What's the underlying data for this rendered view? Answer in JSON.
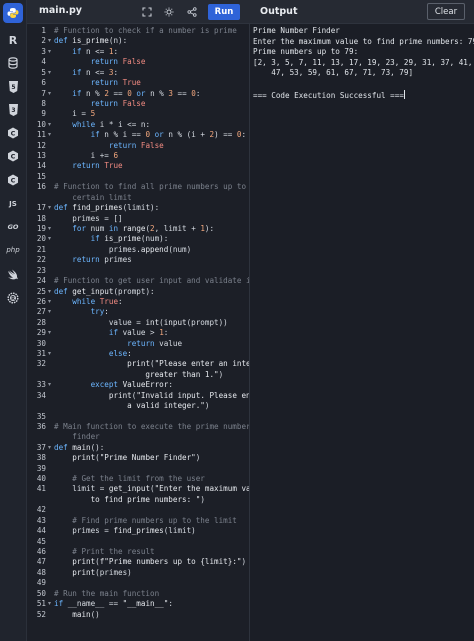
{
  "header": {
    "file_tab": "main.py",
    "run_label": "Run",
    "output_title": "Output",
    "clear_label": "Clear"
  },
  "rail": {
    "icons": [
      "python-icon",
      "r-icon",
      "database-icon",
      "html5-icon",
      "javascript-icon",
      "c-icon",
      "cpp-icon",
      "csharp-icon",
      "js-icon",
      "go-icon",
      "php-icon",
      "swift-icon",
      "rust-icon"
    ],
    "labels": {
      "js": "JS",
      "go": "GO",
      "php": "php"
    }
  },
  "editor": {
    "lines": [
      {
        "n": "1",
        "fold": false,
        "html": "<span class='com'># Function to check if a number is prime</span>"
      },
      {
        "n": "2",
        "fold": true,
        "html": "<span class='kw'>def</span> <span class='fn'>is_prime</span>(n):"
      },
      {
        "n": "3",
        "fold": true,
        "html": "    <span class='kw'>if</span> n &lt;= <span class='num'>1</span>:"
      },
      {
        "n": "4",
        "fold": false,
        "html": "        <span class='kw'>return</span> <span class='bool'>False</span>"
      },
      {
        "n": "5",
        "fold": true,
        "html": "    <span class='kw'>if</span> n &lt;= <span class='num'>3</span>:"
      },
      {
        "n": "6",
        "fold": false,
        "html": "        <span class='kw'>return</span> <span class='bool'>True</span>"
      },
      {
        "n": "7",
        "fold": true,
        "html": "    <span class='kw'>if</span> n % <span class='num'>2</span> == <span class='num'>0</span> <span class='kw'>or</span> n % <span class='num'>3</span> == <span class='num'>0</span>:"
      },
      {
        "n": "8",
        "fold": false,
        "html": "        <span class='kw'>return</span> <span class='bool'>False</span>"
      },
      {
        "n": "9",
        "fold": false,
        "html": "    i = <span class='num'>5</span>"
      },
      {
        "n": "10",
        "fold": true,
        "html": "    <span class='kw'>while</span> i * i &lt;= n:"
      },
      {
        "n": "11",
        "fold": true,
        "html": "        <span class='kw'>if</span> n % i == <span class='num'>0</span> <span class='kw'>or</span> n % (i + <span class='num'>2</span>) == <span class='num'>0</span>:"
      },
      {
        "n": "12",
        "fold": false,
        "html": "            <span class='kw'>return</span> <span class='bool'>False</span>"
      },
      {
        "n": "13",
        "fold": false,
        "html": "        i += <span class='num'>6</span>"
      },
      {
        "n": "14",
        "fold": false,
        "html": "    <span class='kw'>return</span> <span class='bool'>True</span>"
      },
      {
        "n": "15",
        "fold": false,
        "html": ""
      },
      {
        "n": "16",
        "fold": false,
        "html": "<span class='com'># Function to find all prime numbers up to a</span>",
        "wrap": "<span class='com'>    certain limit</span>"
      },
      {
        "n": "17",
        "fold": true,
        "html": "<span class='kw'>def</span> <span class='fn'>find_primes</span>(limit):"
      },
      {
        "n": "18",
        "fold": false,
        "html": "    primes = []"
      },
      {
        "n": "19",
        "fold": true,
        "html": "    <span class='kw'>for</span> num <span class='kw'>in</span> <span class='fn'>range</span>(<span class='num'>2</span>, limit + <span class='num'>1</span>):"
      },
      {
        "n": "20",
        "fold": true,
        "html": "        <span class='kw'>if</span> <span class='fn'>is_prime</span>(num):"
      },
      {
        "n": "21",
        "fold": false,
        "html": "            primes.<span class='fn'>append</span>(num)"
      },
      {
        "n": "22",
        "fold": false,
        "html": "    <span class='kw'>return</span> primes"
      },
      {
        "n": "23",
        "fold": false,
        "html": ""
      },
      {
        "n": "24",
        "fold": false,
        "html": "<span class='com'># Function to get user input and validate it</span>"
      },
      {
        "n": "25",
        "fold": true,
        "html": "<span class='kw'>def</span> <span class='fn'>get_input</span>(prompt):"
      },
      {
        "n": "26",
        "fold": true,
        "html": "    <span class='kw'>while</span> <span class='bool'>True</span>:"
      },
      {
        "n": "27",
        "fold": true,
        "html": "        <span class='kw'>try</span>:"
      },
      {
        "n": "28",
        "fold": false,
        "html": "            value = <span class='fn'>int</span>(<span class='fn'>input</span>(prompt))"
      },
      {
        "n": "29",
        "fold": true,
        "html": "            <span class='kw'>if</span> value &gt; <span class='num'>1</span>:"
      },
      {
        "n": "30",
        "fold": false,
        "html": "                <span class='kw'>return</span> value"
      },
      {
        "n": "31",
        "fold": true,
        "html": "            <span class='kw'>else</span>:"
      },
      {
        "n": "32",
        "fold": false,
        "html": "                <span class='fn'>print</span>(<span class='str'>\"Please enter an integer</span>",
        "wrap": "<span class='str'>                    greater than 1.\"</span>)"
      },
      {
        "n": "33",
        "fold": true,
        "html": "        <span class='kw'>except</span> <span class='fn'>ValueError</span>:"
      },
      {
        "n": "34",
        "fold": false,
        "html": "            <span class='fn'>print</span>(<span class='str'>\"Invalid input. Please enter</span>",
        "wrap": "<span class='str'>                a valid integer.\"</span>)"
      },
      {
        "n": "35",
        "fold": false,
        "html": ""
      },
      {
        "n": "36",
        "fold": false,
        "html": "<span class='com'># Main function to execute the prime number</span>",
        "wrap": "<span class='com'>    finder</span>"
      },
      {
        "n": "37",
        "fold": true,
        "html": "<span class='kw'>def</span> <span class='fn'>main</span>():"
      },
      {
        "n": "38",
        "fold": false,
        "html": "    <span class='fn'>print</span>(<span class='str'>\"Prime Number Finder\"</span>)"
      },
      {
        "n": "39",
        "fold": false,
        "html": ""
      },
      {
        "n": "40",
        "fold": false,
        "html": "    <span class='com'># Get the limit from the user</span>"
      },
      {
        "n": "41",
        "fold": false,
        "html": "    limit = <span class='fn'>get_input</span>(<span class='str'>\"Enter the maximum value</span>",
        "wrap": "<span class='str'>        to find prime numbers: \"</span>)"
      },
      {
        "n": "42",
        "fold": false,
        "html": ""
      },
      {
        "n": "43",
        "fold": false,
        "html": "    <span class='com'># Find prime numbers up to the limit</span>"
      },
      {
        "n": "44",
        "fold": false,
        "html": "    primes = <span class='fn'>find_primes</span>(limit)"
      },
      {
        "n": "45",
        "fold": false,
        "html": ""
      },
      {
        "n": "46",
        "fold": false,
        "html": "    <span class='com'># Print the result</span>"
      },
      {
        "n": "47",
        "fold": false,
        "html": "    <span class='fn'>print</span>(<span class='str'>f\"Prime numbers up to {limit}:\"</span>)"
      },
      {
        "n": "48",
        "fold": false,
        "html": "    <span class='fn'>print</span>(primes)"
      },
      {
        "n": "49",
        "fold": false,
        "html": ""
      },
      {
        "n": "50",
        "fold": false,
        "html": "<span class='com'># Run the main function</span>"
      },
      {
        "n": "51",
        "fold": true,
        "html": "<span class='kw'>if</span> __name__ == <span class='str'>\"__main__\"</span>:"
      },
      {
        "n": "52",
        "fold": false,
        "html": "    <span class='fn'>main</span>()"
      }
    ]
  },
  "output": {
    "lines": [
      "Prime Number Finder",
      "Enter the maximum value to find prime numbers: 79",
      "Prime numbers up to 79:",
      "[2, 3, 5, 7, 11, 13, 17, 19, 23, 29, 31, 37, 41, 43,",
      "    47, 53, 59, 61, 67, 71, 73, 79]",
      "",
      "=== Code Execution Successful ==="
    ]
  },
  "colors": {
    "accent": "#2f63d8",
    "keyword": "#6cb6ff",
    "number": "#f5a97f",
    "boolean": "#f28b82",
    "comment": "#7b818c"
  }
}
